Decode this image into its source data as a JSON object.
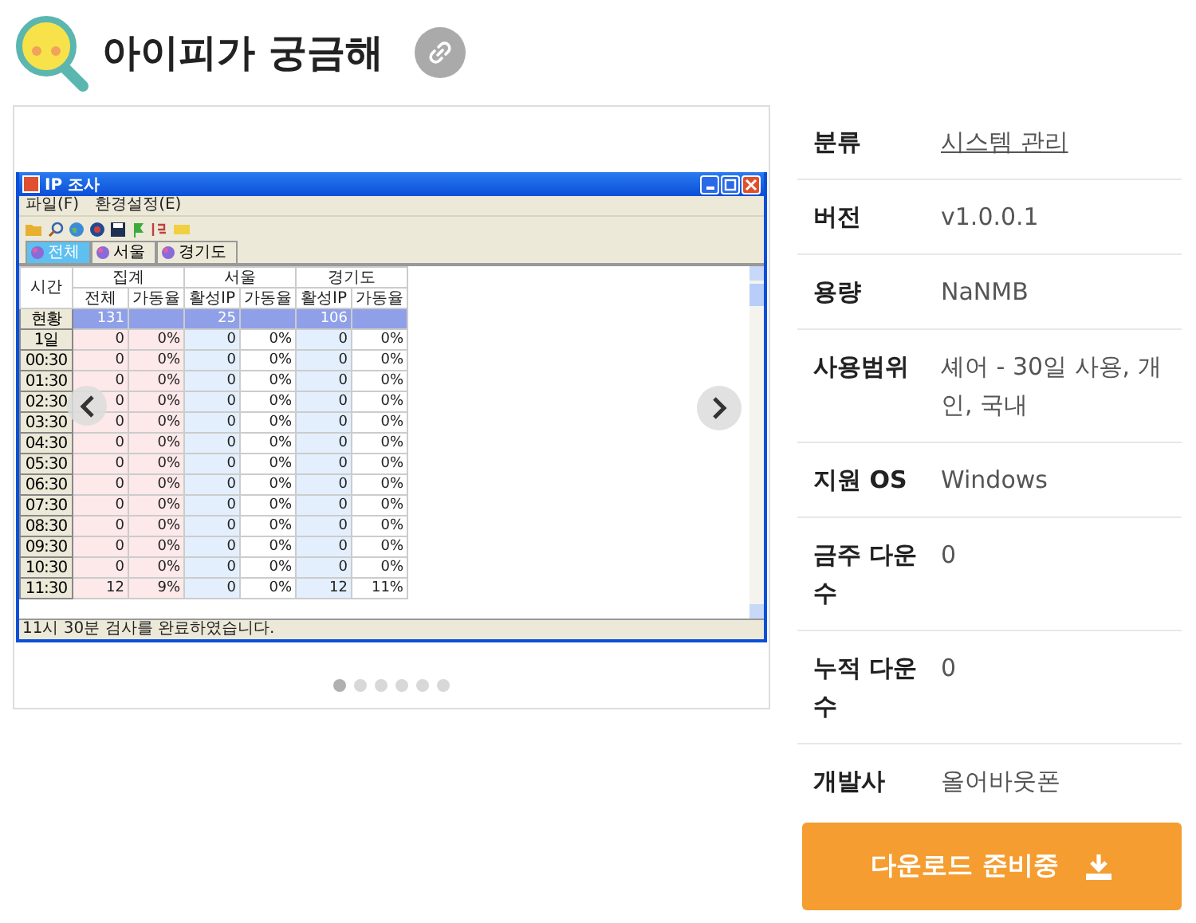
{
  "header": {
    "title": "아이피가 궁금해"
  },
  "gallery": {
    "app_window": {
      "title": "IP 조사",
      "menu": [
        "파일(F)",
        "환경설정(E)"
      ],
      "tabs": [
        {
          "label": "전체",
          "selected": true
        },
        {
          "label": "서울",
          "selected": false
        },
        {
          "label": "경기도",
          "selected": false
        }
      ],
      "table": {
        "corner": "시간",
        "groups": [
          {
            "label": "집계",
            "columns": [
              "전체",
              "가동율"
            ]
          },
          {
            "label": "서울",
            "columns": [
              "활성IP",
              "가동율"
            ]
          },
          {
            "label": "경기도",
            "columns": [
              "활성IP",
              "가동율"
            ]
          }
        ],
        "rows": [
          {
            "kind": "summary",
            "label": "현황",
            "values": [
              "131",
              "25",
              "106"
            ]
          },
          {
            "kind": "data",
            "label": "1일",
            "values": [
              "0",
              "0%",
              "0",
              "0%",
              "0",
              "0%"
            ]
          },
          {
            "kind": "data",
            "label": "00:30",
            "values": [
              "0",
              "0%",
              "0",
              "0%",
              "0",
              "0%"
            ]
          },
          {
            "kind": "data",
            "label": "01:30",
            "values": [
              "0",
              "0%",
              "0",
              "0%",
              "0",
              "0%"
            ]
          },
          {
            "kind": "data",
            "label": "02:30",
            "values": [
              "0",
              "0%",
              "0",
              "0%",
              "0",
              "0%"
            ]
          },
          {
            "kind": "data",
            "label": "03:30",
            "values": [
              "0",
              "0%",
              "0",
              "0%",
              "0",
              "0%"
            ]
          },
          {
            "kind": "data",
            "label": "04:30",
            "values": [
              "0",
              "0%",
              "0",
              "0%",
              "0",
              "0%"
            ]
          },
          {
            "kind": "data",
            "label": "05:30",
            "values": [
              "0",
              "0%",
              "0",
              "0%",
              "0",
              "0%"
            ]
          },
          {
            "kind": "data",
            "label": "06:30",
            "values": [
              "0",
              "0%",
              "0",
              "0%",
              "0",
              "0%"
            ]
          },
          {
            "kind": "data",
            "label": "07:30",
            "values": [
              "0",
              "0%",
              "0",
              "0%",
              "0",
              "0%"
            ]
          },
          {
            "kind": "data",
            "label": "08:30",
            "values": [
              "0",
              "0%",
              "0",
              "0%",
              "0",
              "0%"
            ]
          },
          {
            "kind": "data",
            "label": "09:30",
            "values": [
              "0",
              "0%",
              "0",
              "0%",
              "0",
              "0%"
            ]
          },
          {
            "kind": "data",
            "label": "10:30",
            "values": [
              "0",
              "0%",
              "0",
              "0%",
              "0",
              "0%"
            ]
          },
          {
            "kind": "data",
            "label": "11:30",
            "values": [
              "12",
              "9%",
              "0",
              "0%",
              "12",
              "11%"
            ]
          }
        ]
      },
      "status": "11시 30분 검사를 완료하였습니다."
    },
    "dots": [
      {
        "selected": true
      },
      {
        "selected": false
      },
      {
        "selected": false
      },
      {
        "selected": false
      },
      {
        "selected": false
      },
      {
        "selected": false
      }
    ]
  },
  "info": [
    {
      "label": "분류",
      "value": "시스템 관리",
      "kind": "link"
    },
    {
      "label": "버전",
      "value": "v1.0.0.1",
      "kind": "text"
    },
    {
      "label": "용량",
      "value": "NaNMB",
      "kind": "text"
    },
    {
      "label": "사용범위",
      "value": "셰어 - 30일 사용, 개인, 국내",
      "kind": "text"
    },
    {
      "label": "지원 OS",
      "value": "Windows",
      "kind": "text"
    },
    {
      "label": "금주 다운수",
      "value": "0",
      "kind": "text"
    },
    {
      "label": "누적 다운수",
      "value": "0",
      "kind": "text"
    },
    {
      "label": "개발사",
      "value": "올어바웃폰",
      "kind": "text"
    }
  ],
  "download_button": {
    "label": "다운로드 준비중"
  }
}
